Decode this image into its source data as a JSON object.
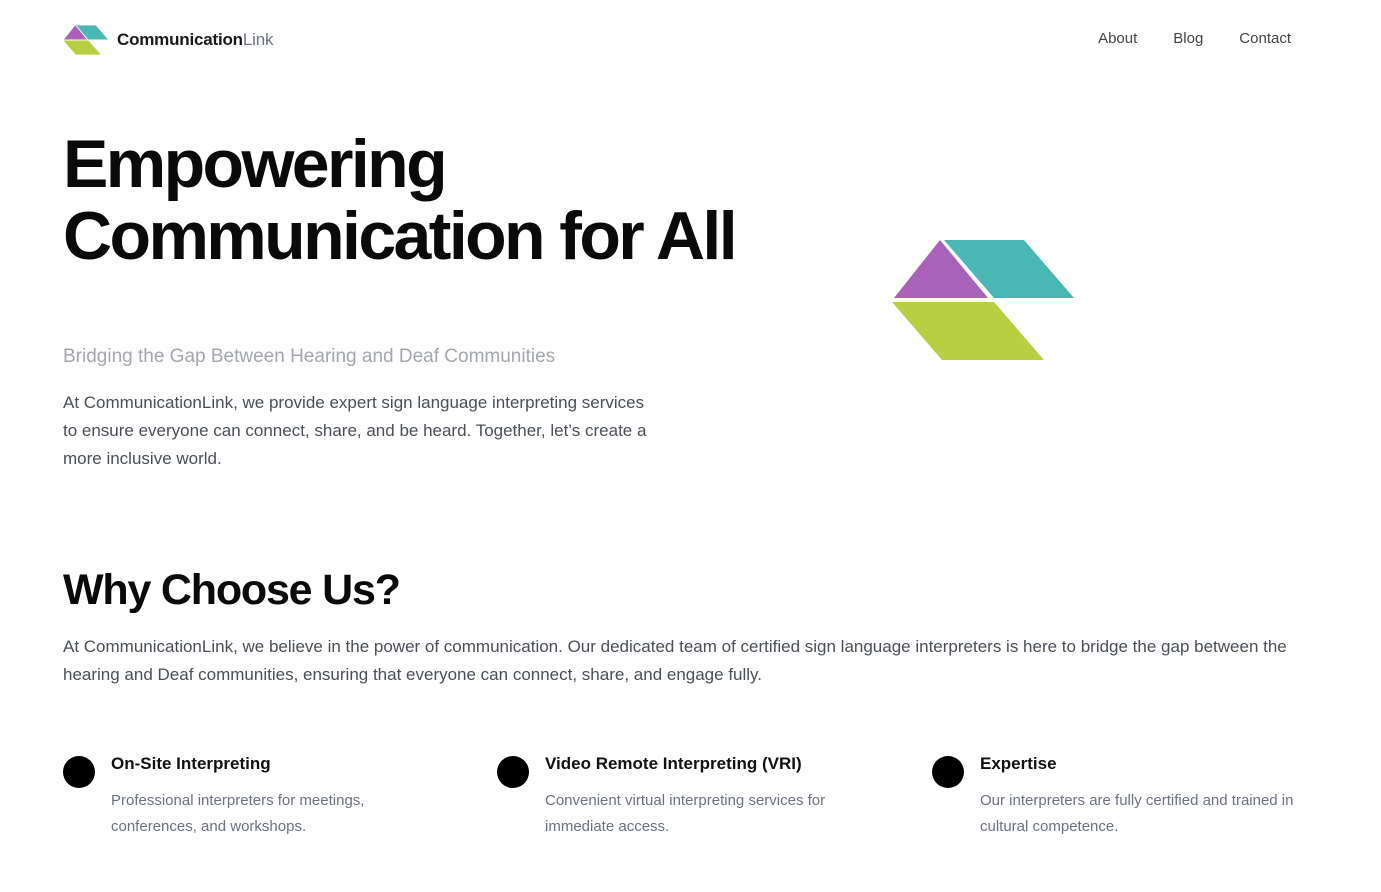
{
  "header": {
    "logo_bold": "Communication",
    "logo_light": "Link",
    "nav": [
      "About",
      "Blog",
      "Contact"
    ]
  },
  "hero": {
    "title": "Empowering Communication for All",
    "subtitle": "Bridging the Gap Between Hearing and Deaf Communities",
    "text": "At CommunicationLink, we provide expert sign language interpreting services to ensure everyone can connect, share, and be heard. Together, let’s create a more inclusive world."
  },
  "why": {
    "title": "Why Choose Us?",
    "text": "At CommunicationLink, we believe in the power of communication. Our dedicated team of certified sign language interpreters is here to bridge the gap between the hearing and Deaf communities, ensuring that everyone can connect, share, and engage fully."
  },
  "features": [
    {
      "title": "On-Site Interpreting",
      "desc": "Professional interpreters for meetings, conferences, and workshops."
    },
    {
      "title": "Video Remote Interpreting (VRI)",
      "desc": "Convenient virtual interpreting services for immediate access."
    },
    {
      "title": "Expertise",
      "desc": "Our interpreters are fully certified and trained in cultural competence."
    }
  ],
  "colors": {
    "purple": "#a962b9",
    "teal": "#49b8b4",
    "lime": "#b8cf41"
  }
}
